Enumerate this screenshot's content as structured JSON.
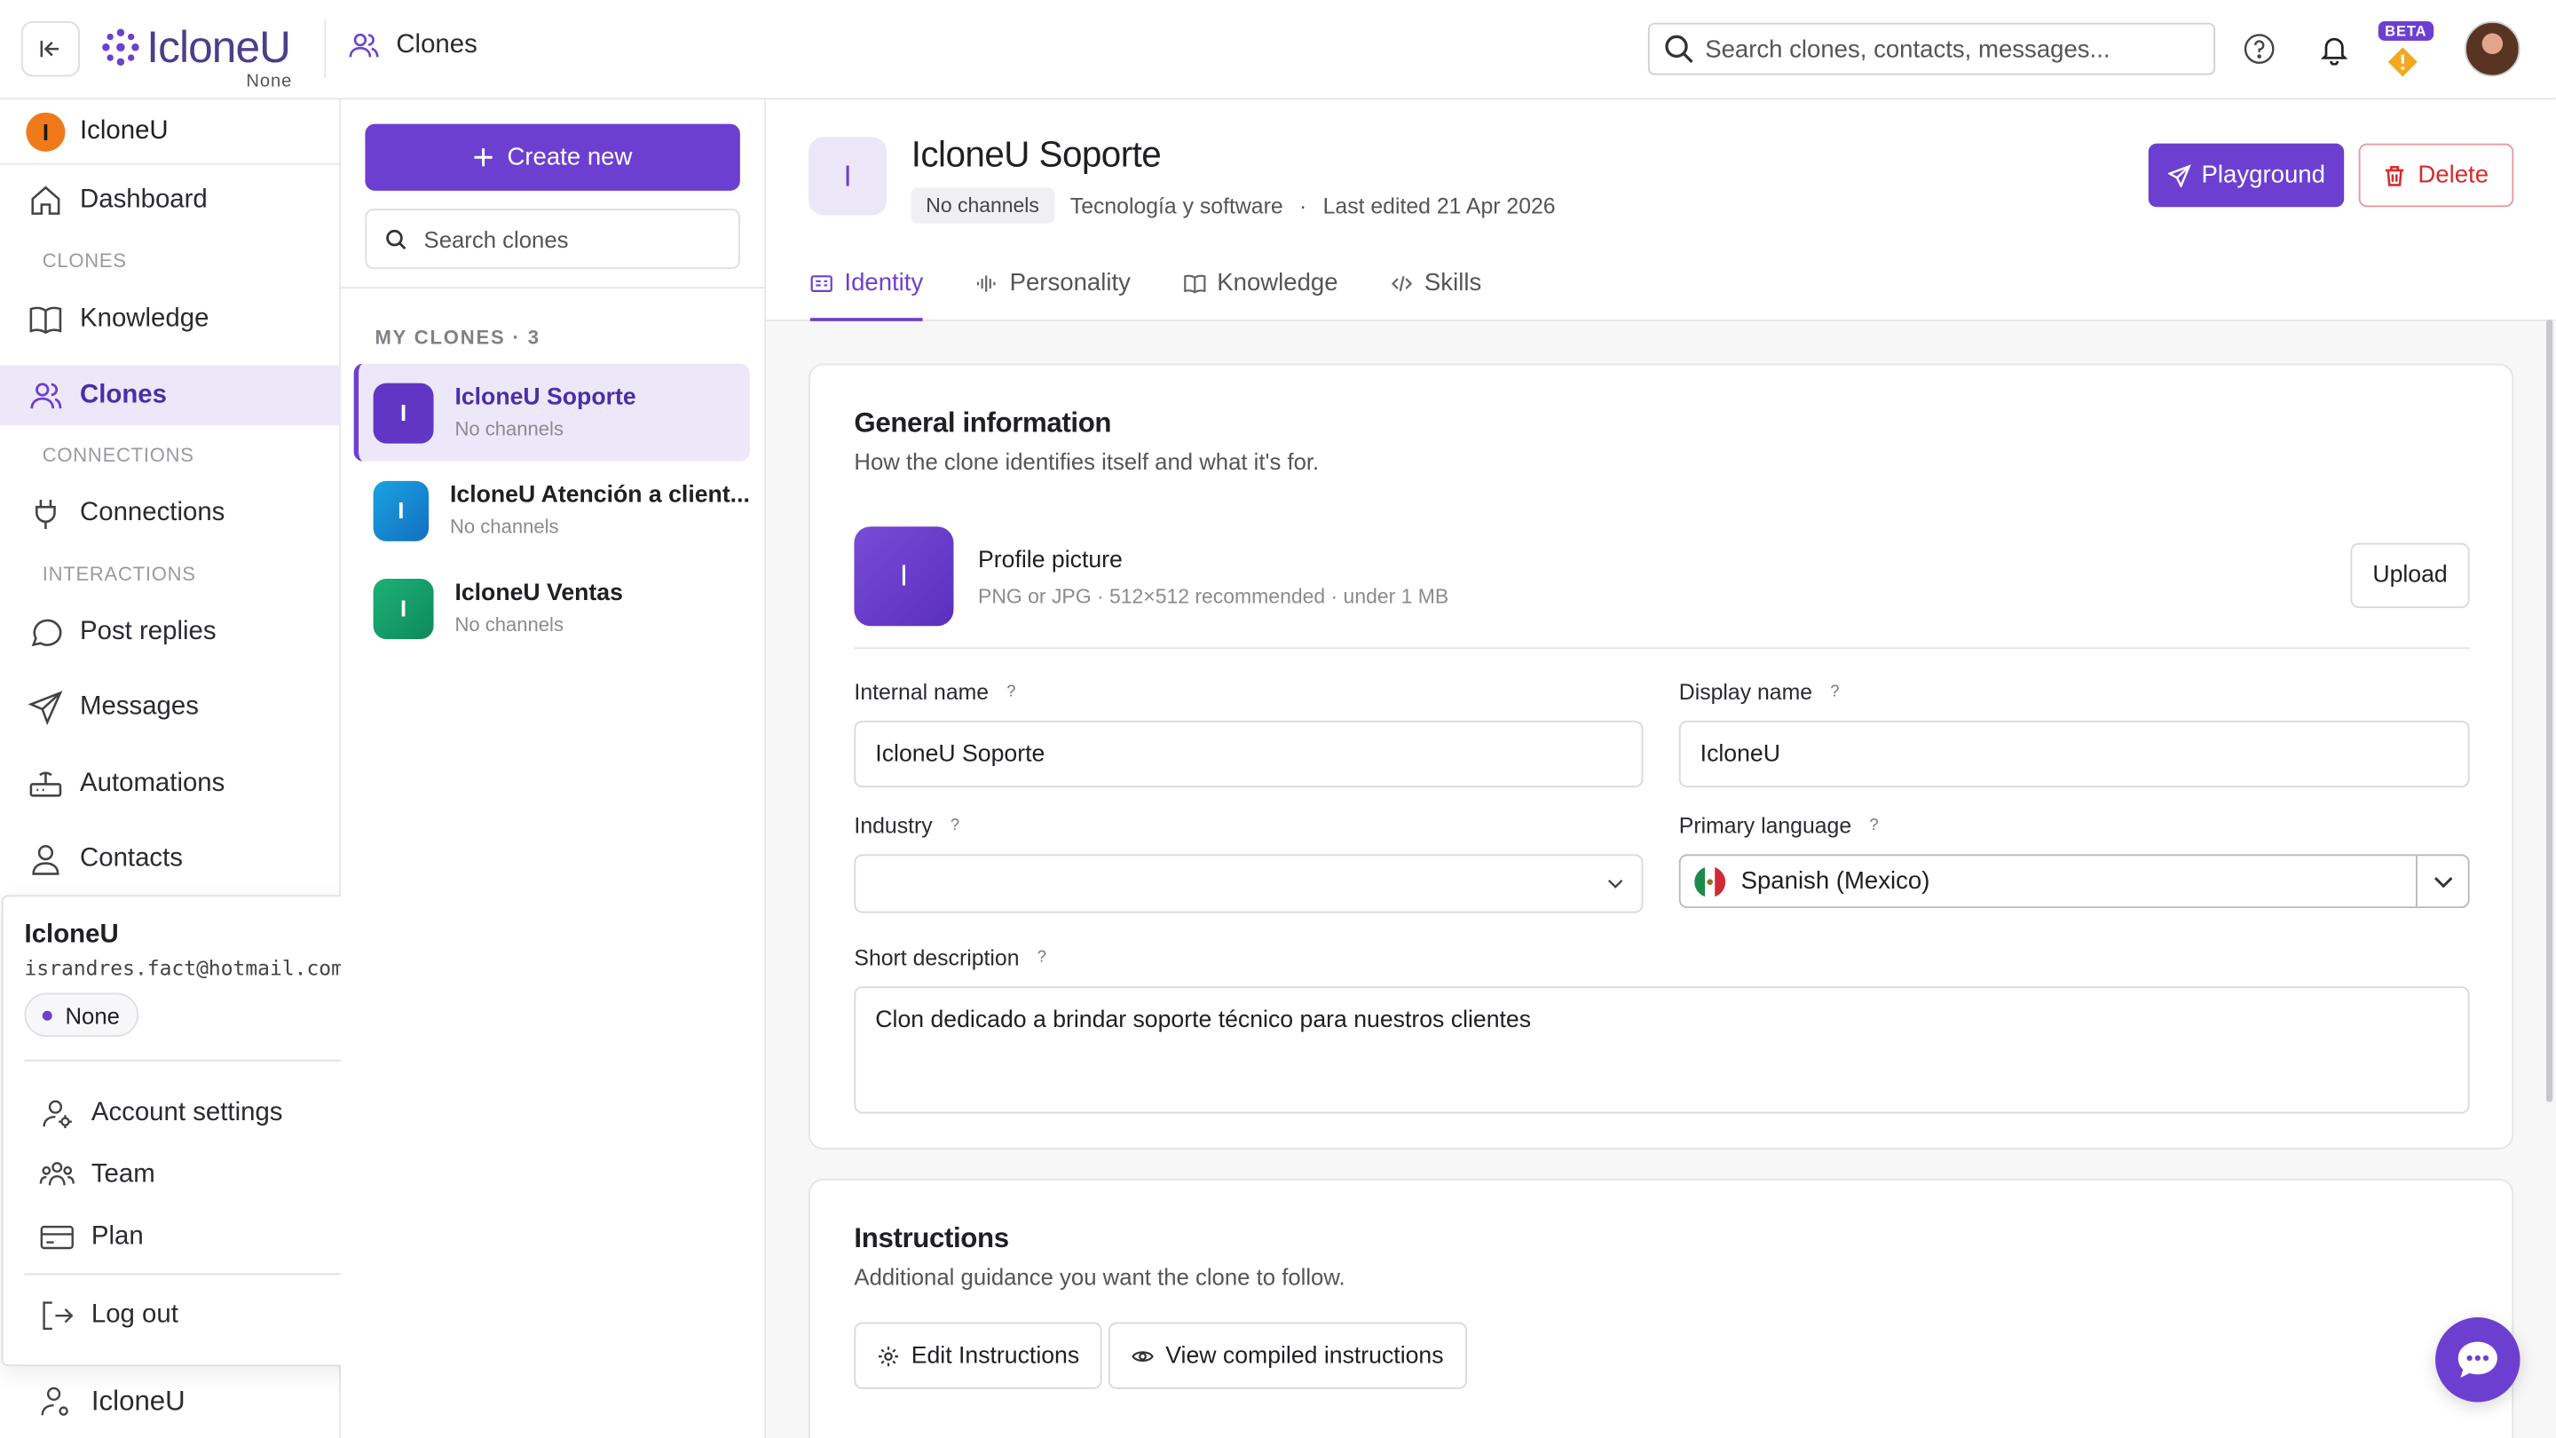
{
  "app": {
    "logo_text": "IcloneU",
    "logo_sub": "None"
  },
  "breadcrumb": {
    "label": "Clones"
  },
  "search": {
    "placeholder": "Search clones, contacts, messages..."
  },
  "header": {
    "beta_badge": "BETA"
  },
  "sidebar": {
    "org_initial": "I",
    "org_name": "IcloneU",
    "items": [
      {
        "label": "Dashboard"
      },
      {
        "section": "CLONES"
      },
      {
        "label": "Knowledge"
      },
      {
        "label": "Clones"
      },
      {
        "section": "CONNECTIONS"
      },
      {
        "label": "Connections"
      },
      {
        "section": "INTERACTIONS"
      },
      {
        "label": "Post replies"
      },
      {
        "label": "Messages"
      },
      {
        "label": "Automations"
      },
      {
        "label": "Contacts"
      }
    ],
    "bottom_user": "IcloneU"
  },
  "user_menu": {
    "name": "IcloneU",
    "email": "israndres.fact@hotmail.com",
    "plan_badge": "None",
    "items": [
      {
        "label": "Account settings"
      },
      {
        "label": "Team"
      },
      {
        "label": "Plan"
      },
      {
        "label": "Log out"
      }
    ]
  },
  "clones_panel": {
    "create_label": "Create new",
    "search_placeholder": "Search clones",
    "section_label": "MY CLONES · 3",
    "clones": [
      {
        "initial": "I",
        "name": "IcloneU Soporte",
        "sub": "No channels",
        "color": "#6236c4"
      },
      {
        "initial": "I",
        "name": "IcloneU Atención a client...",
        "sub": "No channels",
        "color": "#1b8fd4"
      },
      {
        "initial": "I",
        "name": "IcloneU Ventas",
        "sub": "No channels",
        "color": "#16a06a"
      }
    ]
  },
  "detail": {
    "avatar_initial": "I",
    "title": "IcloneU Soporte",
    "channels_chip": "No channels",
    "industry_meta": "Tecnología y software",
    "meta_sep": "·",
    "last_edited": "Last edited 21 Apr 2026",
    "playground_label": "Playground",
    "delete_label": "Delete",
    "tabs": [
      {
        "label": "Identity"
      },
      {
        "label": "Personality"
      },
      {
        "label": "Knowledge"
      },
      {
        "label": "Skills"
      }
    ]
  },
  "general": {
    "title": "General information",
    "subtitle": "How the clone identifies itself and what it's for.",
    "profile_initial": "I",
    "profile_title": "Profile picture",
    "profile_hint": "PNG or JPG · 512×512 recommended · under 1 MB",
    "upload_label": "Upload",
    "help_mark": "?",
    "internal_name_label": "Internal name",
    "internal_name_value": "IcloneU Soporte",
    "display_name_label": "Display name",
    "display_name_value": "IcloneU",
    "industry_label": "Industry",
    "industry_value": "",
    "language_label": "Primary language",
    "language_value": "Spanish (Mexico)",
    "description_label": "Short description",
    "description_value": "Clon dedicado a brindar soporte técnico para nuestros clientes"
  },
  "instructions": {
    "title": "Instructions",
    "subtitle": "Additional guidance you want the clone to follow.",
    "edit_label": "Edit Instructions",
    "view_label": "View compiled instructions"
  },
  "colors": {
    "accent": "#6d3fd1",
    "accent_light": "#ede8f9",
    "danger": "#d62b2b"
  }
}
